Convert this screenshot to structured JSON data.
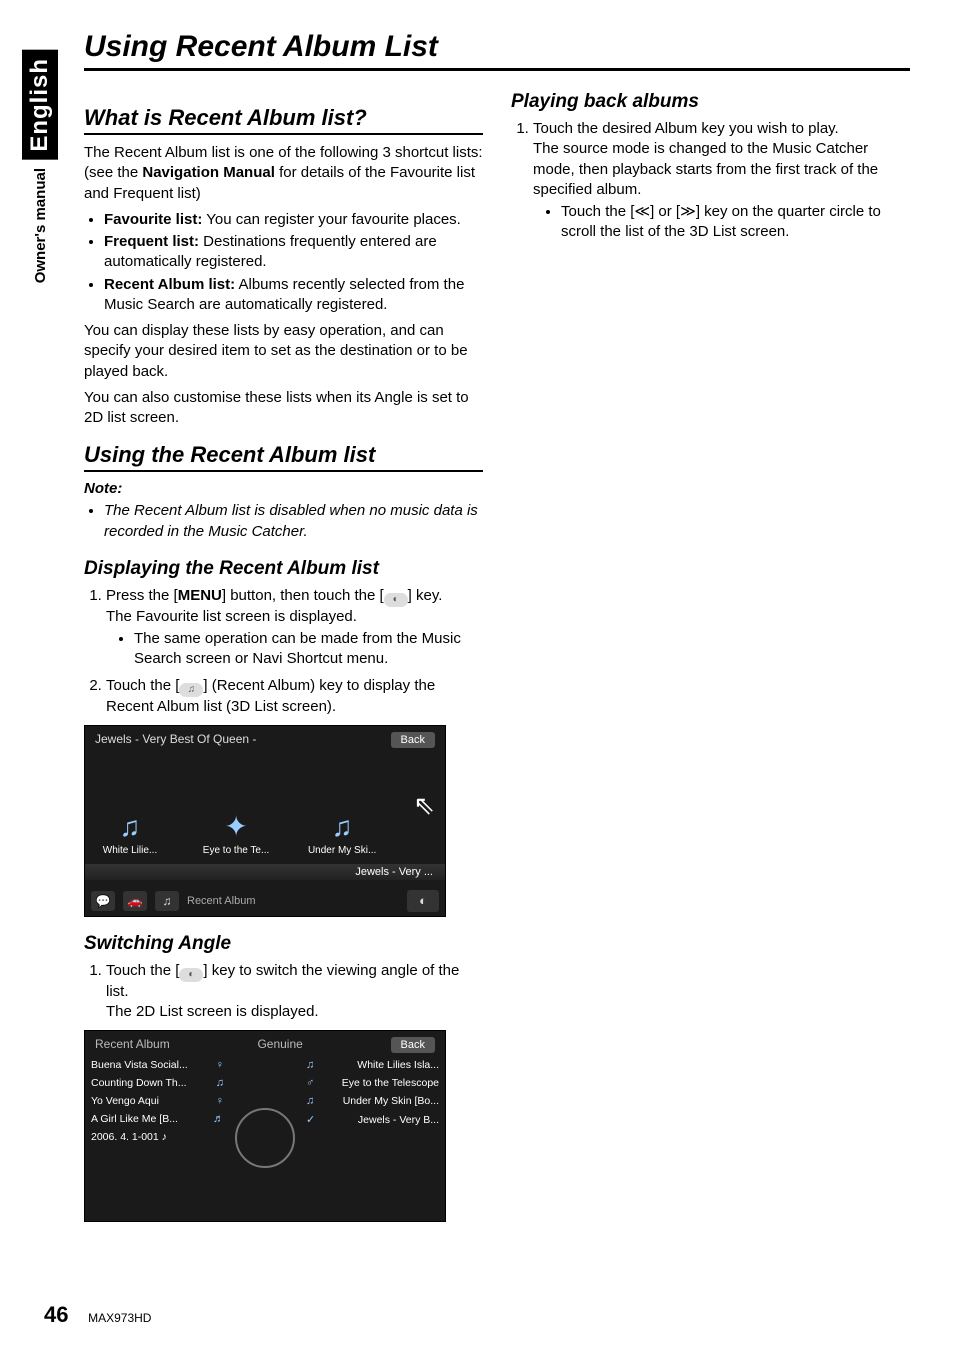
{
  "side": {
    "language": "English",
    "manual_label": "Owner's manual"
  },
  "page_title": "Using Recent Album List",
  "section1": {
    "heading": "What is Recent Album list?",
    "intro": "The Recent Album list is one of the following 3 shortcut lists: (see the Navigation Manual for details of the Favourite list and Frequent list)",
    "bold_nav": "Navigation Manual",
    "bullets": [
      {
        "bold": "Favourite list:",
        "text": " You can register your favourite places."
      },
      {
        "bold": "Frequent list:",
        "text": " Destinations frequently entered are automatically registered."
      },
      {
        "bold": "Recent Album list:",
        "text": " Albums recently selected from the Music Search are automatically registered."
      }
    ],
    "post1": "You can display these lists by easy operation, and can specify your desired item to set as the destination or to be played back.",
    "post2": "You can also customise these lists when its Angle is set to 2D list screen."
  },
  "section2": {
    "heading": "Using the Recent Album list",
    "note_label": "Note:",
    "note_text": "The Recent Album list is disabled when no music data is recorded in the Music Catcher.",
    "sub1": {
      "heading": "Displaying the Recent Album list",
      "step1_a": "Press the [",
      "step1_b": "MENU",
      "step1_c": "] button, then touch the [",
      "step1_d": "] key.",
      "step1_post": "The Favourite list screen is displayed.",
      "step1_sub": "The same operation can be made from the Music Search screen or Navi Shortcut menu.",
      "step2_a": "Touch the [",
      "step2_b": "] (Recent Album) key to display the Recent Album list (3D List screen)."
    },
    "screenshot1": {
      "header_title": "Jewels - Very Best Of Queen -",
      "back": "Back",
      "albums": [
        "White Lilie...",
        "Eye to the Te...",
        "Under My Ski..."
      ],
      "strip": "Jewels - Very ...",
      "footer_label": "Recent Album"
    },
    "sub2": {
      "heading": "Switching Angle",
      "step1_a": "Touch the [",
      "step1_b": "] key to switch the viewing angle of the list.",
      "step1_post": "The 2D List screen is displayed."
    },
    "screenshot2": {
      "top_label": "Recent Album",
      "top_center": "Genuine",
      "back": "Back",
      "left_rows": [
        "Buena Vista Social...",
        "Counting Down Th...",
        "Yo Vengo Aqui",
        "A Girl Like Me [B...",
        "2006. 4. 1-001 ♪"
      ],
      "right_rows": [
        "White Lilies Isla...",
        "Eye to the Telescope",
        "Under My Skin [Bo...",
        "Jewels - Very B..."
      ]
    }
  },
  "rightcol": {
    "heading": "Playing back albums",
    "step1": "Touch the desired Album key you wish to play.",
    "step1_post": "The source mode is changed to the Music Catcher mode, then playback starts from the first track of the specified album.",
    "sub_a": "Touch the [",
    "sub_b": "] or [",
    "sub_c": "] key on the quarter circle to scroll the list of the 3D List screen."
  },
  "footer": {
    "page_number": "46",
    "model": "MAX973HD"
  }
}
